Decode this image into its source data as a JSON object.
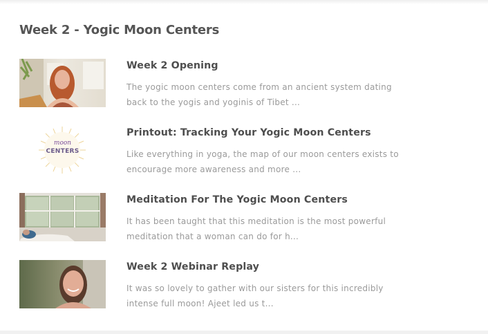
{
  "section": {
    "title": "Week 2 - Yogic Moon Centers"
  },
  "lessons": [
    {
      "title": "Week 2 Opening",
      "description": "The yogic moon centers come from an ancient system dating back to the yogis and yoginis of Tibet ..."
    },
    {
      "title": "Printout: Tracking Your Yogic Moon Centers",
      "description": "Like everything in yoga, the map of our moon centers exists to encourage more awareness and more ...",
      "thumb_text_top": "moon",
      "thumb_text_bottom": "CENTERS"
    },
    {
      "title": "Meditation For The Yogic Moon Centers",
      "description": "It has been taught that this meditation is the most powerful meditation that a woman can do for h..."
    },
    {
      "title": "Week 2 Webinar Replay",
      "description": "It was so lovely to gather with our sisters for this incredibly intense full moon! Ajeet led us t..."
    }
  ]
}
